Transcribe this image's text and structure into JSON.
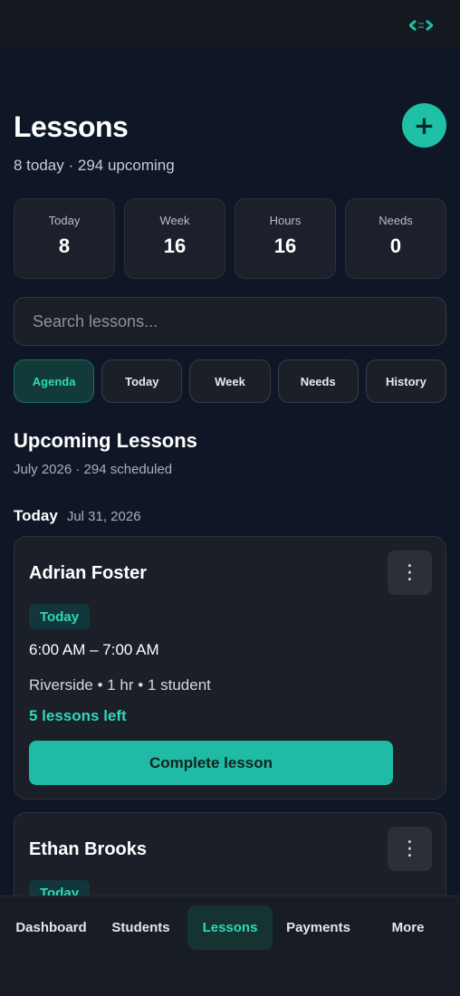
{
  "header": {
    "title": "Lessons",
    "subtitle": "8 today · 294 upcoming",
    "add_label": "+"
  },
  "stats": [
    {
      "label": "Today",
      "value": "8"
    },
    {
      "label": "Week",
      "value": "16"
    },
    {
      "label": "Hours",
      "value": "16"
    },
    {
      "label": "Needs",
      "value": "0"
    }
  ],
  "search": {
    "placeholder": "Search lessons..."
  },
  "filters": [
    {
      "label": "Agenda",
      "active": true
    },
    {
      "label": "Today",
      "active": false
    },
    {
      "label": "Week",
      "active": false
    },
    {
      "label": "Needs",
      "active": false
    },
    {
      "label": "History",
      "active": false
    }
  ],
  "section": {
    "title": "Upcoming Lessons",
    "subtitle": "July 2026 · 294 scheduled"
  },
  "day": {
    "label": "Today",
    "date": "Jul 31, 2026"
  },
  "lessons": [
    {
      "student": "Adrian Foster",
      "badge": "Today",
      "time": "6:00 AM – 7:00 AM",
      "meta": "Riverside • 1 hr • 1 student",
      "remaining": "5 lessons left",
      "action": "Complete lesson",
      "menu": "⋮"
    },
    {
      "student": "Ethan Brooks",
      "badge": "Today",
      "menu": "⋮"
    }
  ],
  "nav": [
    {
      "label": "Dashboard",
      "active": false
    },
    {
      "label": "Students",
      "active": false
    },
    {
      "label": "Lessons",
      "active": true
    },
    {
      "label": "Payments",
      "active": false
    },
    {
      "label": "More",
      "active": false
    }
  ],
  "colors": {
    "accent": "#1fc0a6",
    "accent_text": "#2fd8b8",
    "background": "#0f1726",
    "card": "#1b1f27"
  },
  "icons": {
    "topbar": "code-brackets-icon",
    "add": "plus-icon",
    "menu": "more-vertical-icon"
  }
}
